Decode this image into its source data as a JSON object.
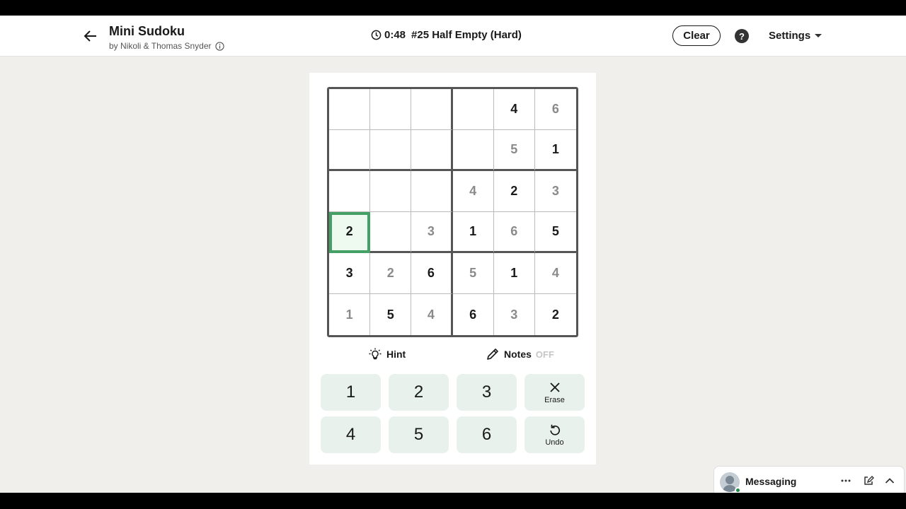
{
  "header": {
    "title": "Mini Sudoku",
    "byline": "by Nikoli & Thomas Snyder",
    "timer": "0:48",
    "puzzle_name": "#25 Half Empty (Hard)",
    "clear_label": "Clear",
    "help_label": "?",
    "settings_label": "Settings"
  },
  "grid": {
    "rows": [
      [
        {
          "v": ""
        },
        {
          "v": ""
        },
        {
          "v": ""
        },
        {
          "v": ""
        },
        {
          "v": "4",
          "t": "given"
        },
        {
          "v": "6",
          "t": "entered"
        }
      ],
      [
        {
          "v": ""
        },
        {
          "v": ""
        },
        {
          "v": ""
        },
        {
          "v": ""
        },
        {
          "v": "5",
          "t": "entered"
        },
        {
          "v": "1",
          "t": "given"
        }
      ],
      [
        {
          "v": ""
        },
        {
          "v": ""
        },
        {
          "v": ""
        },
        {
          "v": "4",
          "t": "entered"
        },
        {
          "v": "2",
          "t": "given"
        },
        {
          "v": "3",
          "t": "entered"
        }
      ],
      [
        {
          "v": "2",
          "t": "given",
          "selected": true
        },
        {
          "v": ""
        },
        {
          "v": "3",
          "t": "entered"
        },
        {
          "v": "1",
          "t": "given"
        },
        {
          "v": "6",
          "t": "entered"
        },
        {
          "v": "5",
          "t": "given"
        }
      ],
      [
        {
          "v": "3",
          "t": "given"
        },
        {
          "v": "2",
          "t": "entered"
        },
        {
          "v": "6",
          "t": "given"
        },
        {
          "v": "5",
          "t": "entered"
        },
        {
          "v": "1",
          "t": "given"
        },
        {
          "v": "4",
          "t": "entered"
        }
      ],
      [
        {
          "v": "1",
          "t": "entered"
        },
        {
          "v": "5",
          "t": "given"
        },
        {
          "v": "4",
          "t": "entered"
        },
        {
          "v": "6",
          "t": "given"
        },
        {
          "v": "3",
          "t": "entered"
        },
        {
          "v": "2",
          "t": "given"
        }
      ]
    ]
  },
  "tools": {
    "hint_label": "Hint",
    "notes_label": "Notes",
    "notes_state": "OFF"
  },
  "keypad": {
    "k1": "1",
    "k2": "2",
    "k3": "3",
    "k4": "4",
    "k5": "5",
    "k6": "6",
    "erase_label": "Erase",
    "undo_label": "Undo"
  },
  "messaging": {
    "label": "Messaging"
  },
  "colors": {
    "accent_green": "#44a064",
    "keypad_bg": "#e8f1ec"
  }
}
